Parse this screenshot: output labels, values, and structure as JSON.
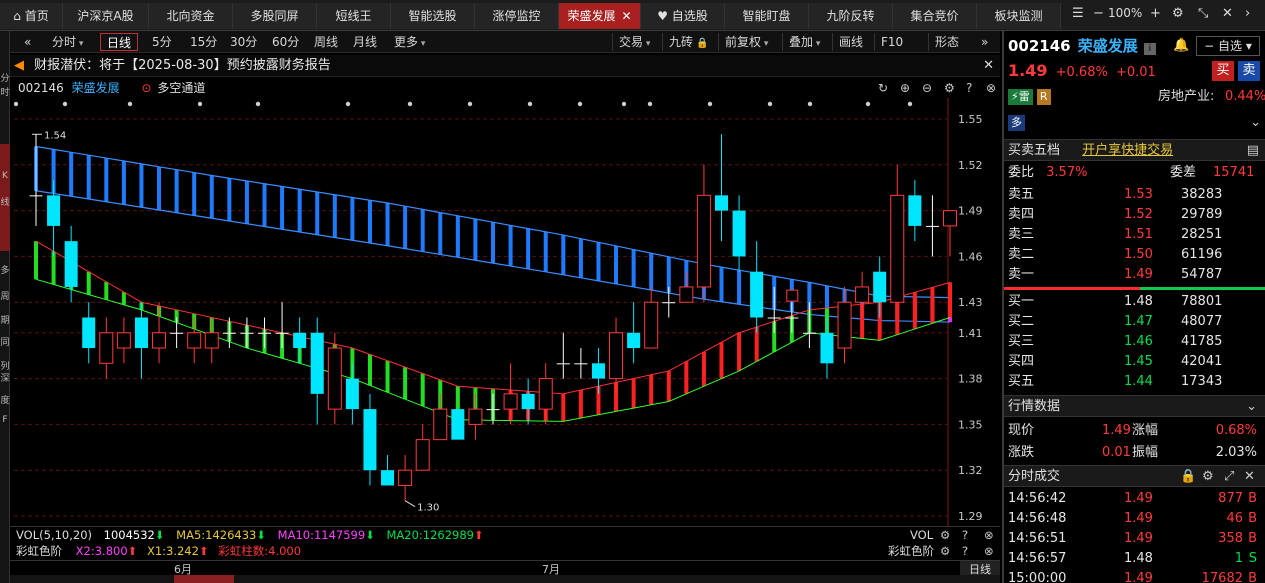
{
  "tabs": [
    {
      "label": "首页",
      "icon": "home-icon"
    },
    {
      "label": "沪深京A股"
    },
    {
      "label": "北向资金"
    },
    {
      "label": "多股同屏"
    },
    {
      "label": "短线王"
    },
    {
      "label": "智能选股"
    },
    {
      "label": "涨停监控"
    },
    {
      "label": "荣盛发展",
      "active": true
    },
    {
      "label": "自选股",
      "icon": "heart-icon"
    },
    {
      "label": "智能盯盘"
    },
    {
      "label": "九阶反转"
    },
    {
      "label": "集合竞价"
    },
    {
      "label": "板块监测"
    }
  ],
  "zoom": "100%",
  "periods": [
    "分时",
    "日线",
    "5分",
    "15分",
    "30分",
    "60分",
    "周线",
    "月线",
    "更多"
  ],
  "period_selected": "日线",
  "right_tools": [
    "交易",
    "九砖",
    "前复权",
    "叠加",
    "画线",
    "F10",
    "形态"
  ],
  "notice": "财报潜伏：将于【2025-08-30】预约披露财务报告",
  "chart_header": {
    "code": "002146",
    "name": "荣盛发展",
    "channel": "多空通道"
  },
  "left_strip_labels": [
    "分",
    "时",
    "K",
    "线",
    "多",
    "周",
    "期",
    "同",
    "列",
    "深",
    "度",
    "F"
  ],
  "colors": {
    "up": "#ff3b3b",
    "down": "#00e6ff",
    "blue_band": "#1e7bff",
    "green_band": "#22dd22",
    "red_band": "#ff2020",
    "magenta": "#ff20ff",
    "accent_red": "#a82020"
  },
  "chart_data": {
    "type": "candlestick",
    "y_ticks": [
      "1.55",
      "1.52",
      "1.49",
      "1.46",
      "1.43",
      "1.41",
      "1.38",
      "1.35",
      "1.32",
      "1.29"
    ],
    "ylim": [
      1.29,
      1.55
    ],
    "high_label": "1.54",
    "low_label": "1.30",
    "x_labels": [
      "6月",
      "7月"
    ],
    "candles": [
      {
        "o": 1.5,
        "c": 1.5,
        "h": 1.54,
        "l": 1.48
      },
      {
        "o": 1.5,
        "c": 1.48,
        "h": 1.51,
        "l": 1.46
      },
      {
        "o": 1.47,
        "c": 1.44,
        "h": 1.48,
        "l": 1.43
      },
      {
        "o": 1.42,
        "c": 1.4,
        "h": 1.43,
        "l": 1.39
      },
      {
        "o": 1.39,
        "c": 1.41,
        "h": 1.42,
        "l": 1.38
      },
      {
        "o": 1.4,
        "c": 1.41,
        "h": 1.42,
        "l": 1.39
      },
      {
        "o": 1.42,
        "c": 1.4,
        "h": 1.43,
        "l": 1.38
      },
      {
        "o": 1.4,
        "c": 1.41,
        "h": 1.43,
        "l": 1.39
      },
      {
        "o": 1.41,
        "c": 1.41,
        "h": 1.42,
        "l": 1.4
      },
      {
        "o": 1.4,
        "c": 1.41,
        "h": 1.42,
        "l": 1.39
      },
      {
        "o": 1.4,
        "c": 1.41,
        "h": 1.42,
        "l": 1.39
      },
      {
        "o": 1.41,
        "c": 1.41,
        "h": 1.42,
        "l": 1.4
      },
      {
        "o": 1.41,
        "c": 1.41,
        "h": 1.42,
        "l": 1.4
      },
      {
        "o": 1.41,
        "c": 1.41,
        "h": 1.42,
        "l": 1.4
      },
      {
        "o": 1.41,
        "c": 1.41,
        "h": 1.43,
        "l": 1.4
      },
      {
        "o": 1.41,
        "c": 1.4,
        "h": 1.42,
        "l": 1.39
      },
      {
        "o": 1.41,
        "c": 1.37,
        "h": 1.42,
        "l": 1.35
      },
      {
        "o": 1.36,
        "c": 1.4,
        "h": 1.41,
        "l": 1.35
      },
      {
        "o": 1.38,
        "c": 1.36,
        "h": 1.39,
        "l": 1.35
      },
      {
        "o": 1.36,
        "c": 1.32,
        "h": 1.37,
        "l": 1.31
      },
      {
        "o": 1.32,
        "c": 1.31,
        "h": 1.33,
        "l": 1.31
      },
      {
        "o": 1.31,
        "c": 1.32,
        "h": 1.33,
        "l": 1.3
      },
      {
        "o": 1.32,
        "c": 1.34,
        "h": 1.35,
        "l": 1.32
      },
      {
        "o": 1.34,
        "c": 1.36,
        "h": 1.37,
        "l": 1.34
      },
      {
        "o": 1.36,
        "c": 1.34,
        "h": 1.36,
        "l": 1.34
      },
      {
        "o": 1.35,
        "c": 1.36,
        "h": 1.37,
        "l": 1.34
      },
      {
        "o": 1.36,
        "c": 1.36,
        "h": 1.37,
        "l": 1.35
      },
      {
        "o": 1.36,
        "c": 1.37,
        "h": 1.39,
        "l": 1.35
      },
      {
        "o": 1.37,
        "c": 1.36,
        "h": 1.38,
        "l": 1.35
      },
      {
        "o": 1.36,
        "c": 1.38,
        "h": 1.39,
        "l": 1.35
      },
      {
        "o": 1.39,
        "c": 1.39,
        "h": 1.41,
        "l": 1.38
      },
      {
        "o": 1.39,
        "c": 1.39,
        "h": 1.4,
        "l": 1.38
      },
      {
        "o": 1.39,
        "c": 1.38,
        "h": 1.4,
        "l": 1.37
      },
      {
        "o": 1.38,
        "c": 1.41,
        "h": 1.42,
        "l": 1.37
      },
      {
        "o": 1.41,
        "c": 1.4,
        "h": 1.43,
        "l": 1.39
      },
      {
        "o": 1.4,
        "c": 1.43,
        "h": 1.44,
        "l": 1.4
      },
      {
        "o": 1.43,
        "c": 1.43,
        "h": 1.44,
        "l": 1.42
      },
      {
        "o": 1.43,
        "c": 1.44,
        "h": 1.45,
        "l": 1.43
      },
      {
        "o": 1.44,
        "c": 1.5,
        "h": 1.52,
        "l": 1.43
      },
      {
        "o": 1.5,
        "c": 1.49,
        "h": 1.54,
        "l": 1.47
      },
      {
        "o": 1.49,
        "c": 1.46,
        "h": 1.5,
        "l": 1.45
      },
      {
        "o": 1.45,
        "c": 1.42,
        "h": 1.47,
        "l": 1.41
      },
      {
        "o": 1.42,
        "c": 1.42,
        "h": 1.44,
        "l": 1.41
      },
      {
        "o": 1.42,
        "c": 1.42,
        "h": 1.43,
        "l": 1.41
      },
      {
        "o": 1.41,
        "c": 1.41,
        "h": 1.43,
        "l": 1.4
      },
      {
        "o": 1.41,
        "c": 1.39,
        "h": 1.42,
        "l": 1.38
      },
      {
        "o": 1.4,
        "c": 1.43,
        "h": 1.44,
        "l": 1.39
      },
      {
        "o": 1.43,
        "c": 1.44,
        "h": 1.45,
        "l": 1.42
      },
      {
        "o": 1.45,
        "c": 1.43,
        "h": 1.46,
        "l": 1.42
      },
      {
        "o": 1.43,
        "c": 1.5,
        "h": 1.52,
        "l": 1.43
      },
      {
        "o": 1.5,
        "c": 1.48,
        "h": 1.51,
        "l": 1.47
      },
      {
        "o": 1.48,
        "c": 1.48,
        "h": 1.5,
        "l": 1.46
      },
      {
        "o": 1.48,
        "c": 1.49,
        "h": 1.49,
        "l": 1.46
      }
    ]
  },
  "indicators": {
    "vol_label": "VOL(5,10,20)",
    "vol_value": "1004532",
    "ma5": "MA5:1426433",
    "ma10": "MA10:1147599",
    "ma20": "MA20:1262989",
    "vol_right": "VOL",
    "rainbow_label": "彩虹色阶",
    "rb_x2": "X2:3.800",
    "rb_x1": "X1:3.242",
    "rb_count": "彩虹柱数:4.000",
    "rainbow_right": "彩虹色阶",
    "period_right": "日线"
  },
  "quote": {
    "code": "002146",
    "name": "荣盛发展",
    "price": "1.49",
    "pct": "+0.68%",
    "chg": "+0.01",
    "buy": "买",
    "sell": "卖",
    "select": "自选",
    "tag_lei": "雷",
    "tag_r": "R",
    "industry": "房地产业:",
    "industry_pct": "0.44%",
    "more": "多"
  },
  "order_book": {
    "title": "买卖五档",
    "link": "开户享快捷交易",
    "ratio_label": "委比",
    "ratio": "3.57%",
    "diff_label": "委差",
    "diff": "15741",
    "sells": [
      {
        "label": "卖五",
        "price": "1.53",
        "vol": "38283"
      },
      {
        "label": "卖四",
        "price": "1.52",
        "vol": "29789"
      },
      {
        "label": "卖三",
        "price": "1.51",
        "vol": "28251"
      },
      {
        "label": "卖二",
        "price": "1.50",
        "vol": "61196"
      },
      {
        "label": "卖一",
        "price": "1.49",
        "vol": "54787"
      }
    ],
    "buys": [
      {
        "label": "买一",
        "price": "1.48",
        "vol": "78801"
      },
      {
        "label": "买二",
        "price": "1.47",
        "vol": "48077"
      },
      {
        "label": "买三",
        "price": "1.46",
        "vol": "41785"
      },
      {
        "label": "买四",
        "price": "1.45",
        "vol": "42041"
      },
      {
        "label": "买五",
        "price": "1.44",
        "vol": "17343"
      }
    ]
  },
  "market": {
    "title": "行情数据",
    "now_label": "现价",
    "now": "1.49",
    "pct_label": "涨幅",
    "pct": "0.68%",
    "chg_label": "涨跌",
    "chg": "0.01",
    "amp_label": "振幅",
    "amp": "2.03%"
  },
  "trades": {
    "title": "分时成交",
    "rows": [
      {
        "time": "14:56:42",
        "price": "1.49",
        "vol": "877",
        "side": "B"
      },
      {
        "time": "14:56:48",
        "price": "1.49",
        "vol": "46",
        "side": "B"
      },
      {
        "time": "14:56:51",
        "price": "1.49",
        "vol": "358",
        "side": "B"
      },
      {
        "time": "14:56:57",
        "price": "1.48",
        "vol": "1",
        "side": "S"
      },
      {
        "time": "15:00:00",
        "price": "1.49",
        "vol": "17682",
        "side": "B"
      }
    ]
  }
}
